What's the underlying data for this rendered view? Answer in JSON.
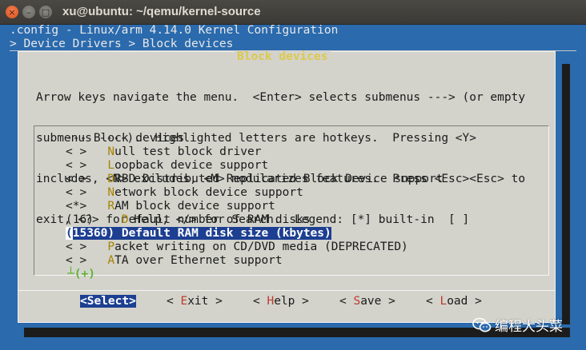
{
  "window": {
    "title": "xu@ubuntu: ~/qemu/kernel-source",
    "close_glyph": "×",
    "min_glyph": "–",
    "max_glyph": "□"
  },
  "header": {
    "line1": ".config - Linux/arm 4.14.0 Kernel Configuration",
    "line2": "> Device Drivers > Block devices"
  },
  "dialog": {
    "title": "Block devices",
    "help_lines": [
      "Arrow keys navigate the menu.  <Enter> selects submenus ---> (or empty",
      "submenus ----).  Highlighted letters are hotkeys.  Pressing <Y>",
      "includes, <N> excludes, <M> modularizes features.  Press <Esc><Esc> to",
      "exit, <?> for Help, </> for Search.  Legend: [*] built-in  [ ]"
    ]
  },
  "menu": {
    "items": [
      {
        "pre": "--- ",
        "hot": "",
        "rest": "Block devices"
      },
      {
        "pre": "< >   ",
        "hot": "N",
        "rest": "ull test block driver"
      },
      {
        "pre": "< >   ",
        "hot": "L",
        "rest": "oopback device support"
      },
      {
        "pre": "< >   ",
        "hot": "D",
        "rest": "RBD Distributed Replicated Block Device support"
      },
      {
        "pre": "< >   ",
        "hot": "N",
        "rest": "etwork block device support"
      },
      {
        "pre": "<*>   ",
        "hot": "R",
        "rest": "AM block device support"
      },
      {
        "pre": "(16)    ",
        "hot": "D",
        "rest": "efault number of RAM disks"
      },
      {
        "cur": "(",
        "pre": "15360) ",
        "hot": "D",
        "rest": "efault RAM disk size (kbytes)"
      },
      {
        "pre": "< >   ",
        "hot": "P",
        "rest": "acket writing on CD/DVD media (DEPRECATED)"
      },
      {
        "pre": "< >   ",
        "hot": "A",
        "rest": "TA over Ethernet support"
      }
    ],
    "more_indicator": "┴(+)"
  },
  "buttons": [
    {
      "open": "<",
      "hot": "S",
      "rest": "elect",
      "close": ">"
    },
    {
      "open": "< ",
      "hot": "E",
      "rest": "xit",
      "close": " >"
    },
    {
      "open": "< ",
      "hot": "H",
      "rest": "elp",
      "close": " >"
    },
    {
      "open": "< ",
      "hot": "S",
      "rest": "ave",
      "close": " >"
    },
    {
      "open": "< ",
      "hot": "L",
      "rest": "oad",
      "close": " >"
    }
  ],
  "watermark": {
    "text": "编程大头菜",
    "icon": "wechat-icon"
  },
  "colors": {
    "terminal_bg": "#2a6aad",
    "dialog_bg": "#d3d3cc",
    "selection_bg": "#1d3f92",
    "hotkey": "#a68300",
    "title": "#dcc94a"
  }
}
